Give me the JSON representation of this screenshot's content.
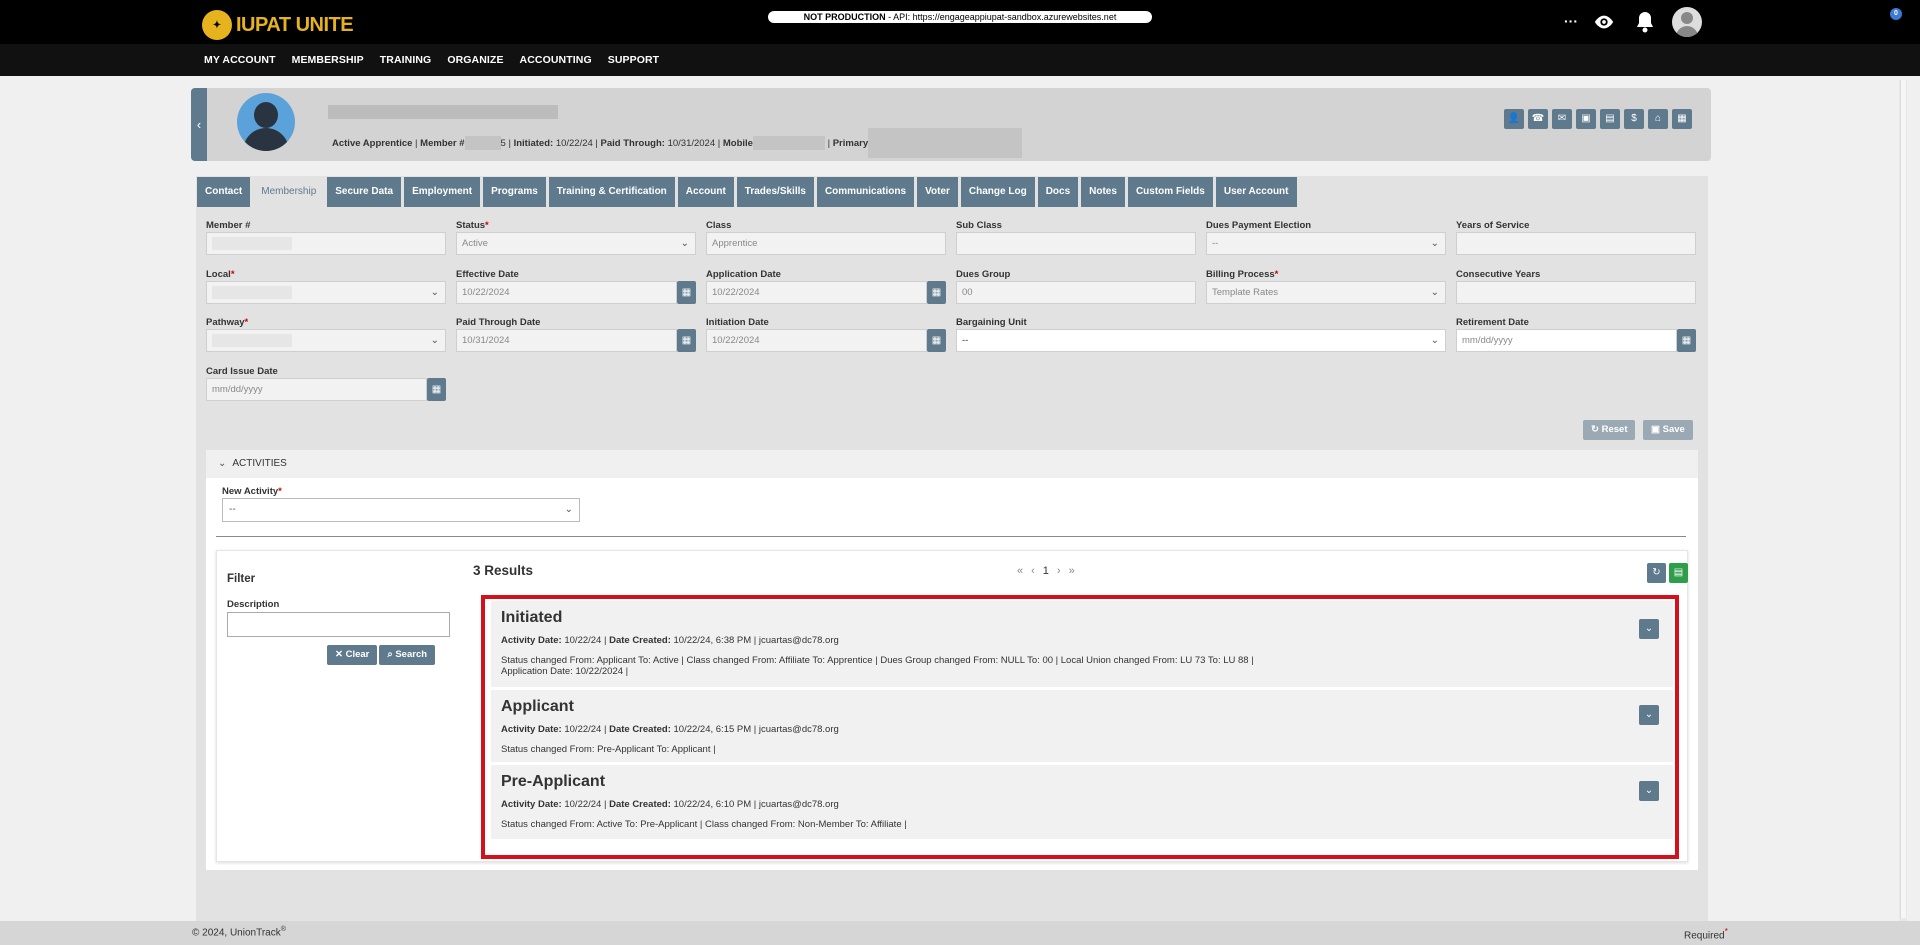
{
  "app": {
    "brand": "IUPAT UNITE",
    "emblem": "IUPAT"
  },
  "env_badge": {
    "bold": "NOT PRODUCTION",
    "text": " - API: https://engageappiupat-sandbox.azurewebsites.net"
  },
  "topbar": {
    "more": "···",
    "notification_count": "0"
  },
  "nav": [
    "MY ACCOUNT",
    "MEMBERSHIP",
    "TRAINING",
    "ORGANIZE",
    "ACCOUNTING",
    "SUPPORT"
  ],
  "profile": {
    "status": "Active Apprentice",
    "member_label": "Member #",
    "member_suffix": "5",
    "initiated_label": "Initiated:",
    "initiated": "10/22/24",
    "paid_label": "Paid Through:",
    "paid": "10/31/2024",
    "mobile_label": "Mobile",
    "primary_label": "Primary"
  },
  "tabs": [
    "Contact",
    "Membership",
    "Secure Data",
    "Employment",
    "Programs",
    "Training & Certification",
    "Account",
    "Trades/Skills",
    "Communications",
    "Voter",
    "Change Log",
    "Docs",
    "Notes",
    "Custom Fields",
    "User Account"
  ],
  "form": {
    "member_no": {
      "label": "Member #",
      "value": ""
    },
    "status": {
      "label": "Status",
      "value": "Active"
    },
    "class": {
      "label": "Class",
      "value": "Apprentice"
    },
    "sub_class": {
      "label": "Sub Class",
      "value": ""
    },
    "dues_payment": {
      "label": "Dues Payment Election",
      "value": "--"
    },
    "years_service": {
      "label": "Years of Service",
      "value": ""
    },
    "local": {
      "label": "Local",
      "value": ""
    },
    "effective_date": {
      "label": "Effective Date",
      "value": "10/22/2024"
    },
    "application_date": {
      "label": "Application Date",
      "value": "10/22/2024"
    },
    "dues_group": {
      "label": "Dues Group",
      "value": "00"
    },
    "billing_process": {
      "label": "Billing Process",
      "value": "Template Rates"
    },
    "consecutive_years": {
      "label": "Consecutive Years",
      "value": ""
    },
    "pathway": {
      "label": "Pathway",
      "value": ""
    },
    "paid_through": {
      "label": "Paid Through Date",
      "value": "10/31/2024"
    },
    "initiation_date": {
      "label": "Initiation Date",
      "value": "10/22/2024"
    },
    "bargaining_unit": {
      "label": "Bargaining Unit",
      "value": "--"
    },
    "retirement_date": {
      "label": "Retirement Date",
      "placeholder": "mm/dd/yyyy"
    },
    "card_issue_date": {
      "label": "Card Issue Date",
      "placeholder": "mm/dd/yyyy"
    },
    "reset": "Reset",
    "save": "Save"
  },
  "activities": {
    "header": "ACTIVITIES",
    "new_activity_label": "New Activity",
    "new_activity_value": "--",
    "filter_title": "Filter",
    "description_label": "Description",
    "clear": "Clear",
    "search": "Search",
    "results_count": "3 Results",
    "pager": {
      "first": "«",
      "prev": "‹",
      "page": "1",
      "next": "›",
      "last": "»"
    },
    "items": [
      {
        "title": "Initiated",
        "activity_date": "10/22/24",
        "date_created": "10/22/24, 6:38 PM",
        "user": "jcuartas@dc78.org",
        "detail1": "Status changed From: Applicant To: Active | Class changed From: Affiliate To: Apprentice | Dues Group changed From: NULL To: 00 | Local Union changed From: LU 73 To: LU 88 |",
        "detail2": "Application Date: 10/22/2024 |"
      },
      {
        "title": "Applicant",
        "activity_date": "10/22/24",
        "date_created": "10/22/24, 6:15 PM",
        "user": "jcuartas@dc78.org",
        "detail1": "Status changed From: Pre-Applicant To: Applicant |",
        "detail2": ""
      },
      {
        "title": "Pre-Applicant",
        "activity_date": "10/22/24",
        "date_created": "10/22/24, 6:10 PM",
        "user": "jcuartas@dc78.org",
        "detail1": "Status changed From: Active To: Pre-Applicant | Class changed From: Non-Member To: Affiliate |",
        "detail2": ""
      }
    ]
  },
  "footer": {
    "copyright": "© 2024, UnionTrack",
    "reg": "®",
    "required": "Required",
    "req_mark": "*"
  },
  "labels": {
    "activity_date": "Activity Date:",
    "date_created": "Date Created:"
  },
  "colors": {
    "accent": "#5f7a8c",
    "brand": "#e6b31e",
    "highlight": "#d4111b",
    "excel": "#2e9e4a"
  }
}
